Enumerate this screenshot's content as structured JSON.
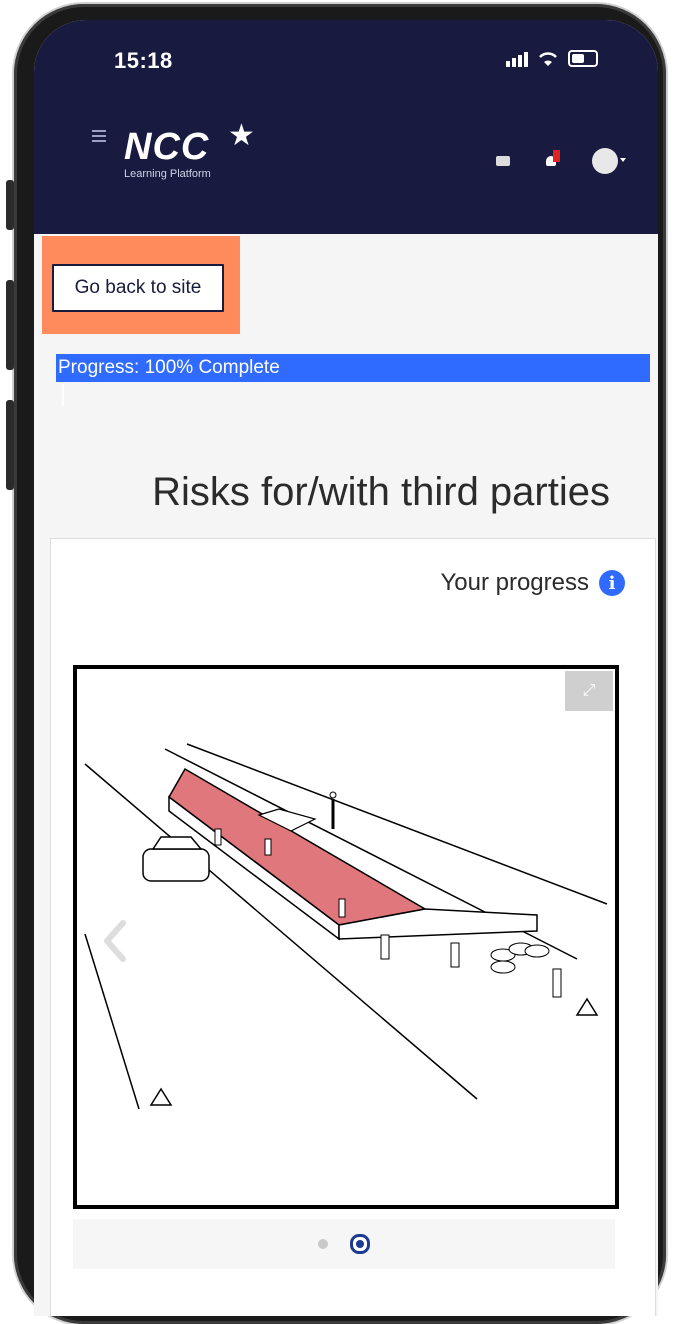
{
  "status_bar": {
    "time": "15:18"
  },
  "header": {
    "logo_main": "NCC",
    "logo_sub": "Learning Platform",
    "icons": [
      "menu-icon",
      "message-icon",
      "bell-icon",
      "avatar-icon"
    ]
  },
  "content": {
    "back_button_label": "Go back to site",
    "progress": {
      "label": "Progress: 100% Complete",
      "fraction": 1.0
    },
    "title": "Risks for/with third parties",
    "your_progress_label": "Your progress",
    "carousel": {
      "slide_count": 2,
      "active_index": 1
    }
  },
  "colors": {
    "header_bg": "#191a3f",
    "progress_bar": "#2f6bff",
    "highlight": "#ff8a5c",
    "hazard_area": "#e0777d"
  }
}
